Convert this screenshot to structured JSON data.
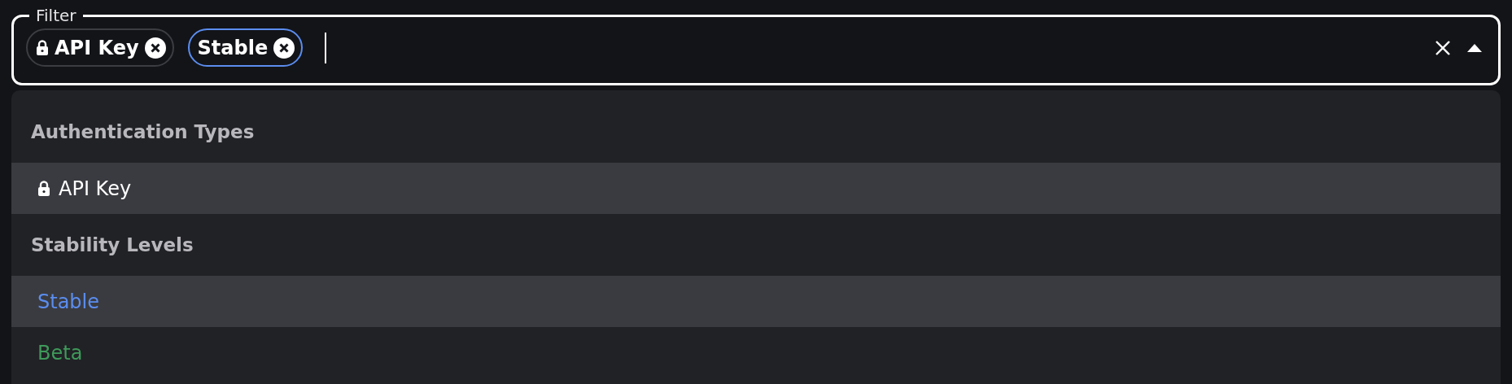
{
  "filter": {
    "label": "Filter",
    "chips": [
      {
        "label": "API Key",
        "kind": "auth",
        "color": "#3c3d42"
      },
      {
        "label": "Stable",
        "kind": "stability",
        "color": "#5b8def"
      }
    ]
  },
  "dropdown": {
    "groups": [
      {
        "title": "Authentication Types",
        "items": [
          {
            "label": "API Key",
            "kind": "auth",
            "color": "#ffffff",
            "selected": true
          }
        ]
      },
      {
        "title": "Stability Levels",
        "items": [
          {
            "label": "Stable",
            "kind": "stability",
            "color": "#5b8def",
            "selected": true
          },
          {
            "label": "Beta",
            "kind": "stability",
            "color": "#3f9a5a",
            "selected": false
          }
        ]
      }
    ]
  }
}
